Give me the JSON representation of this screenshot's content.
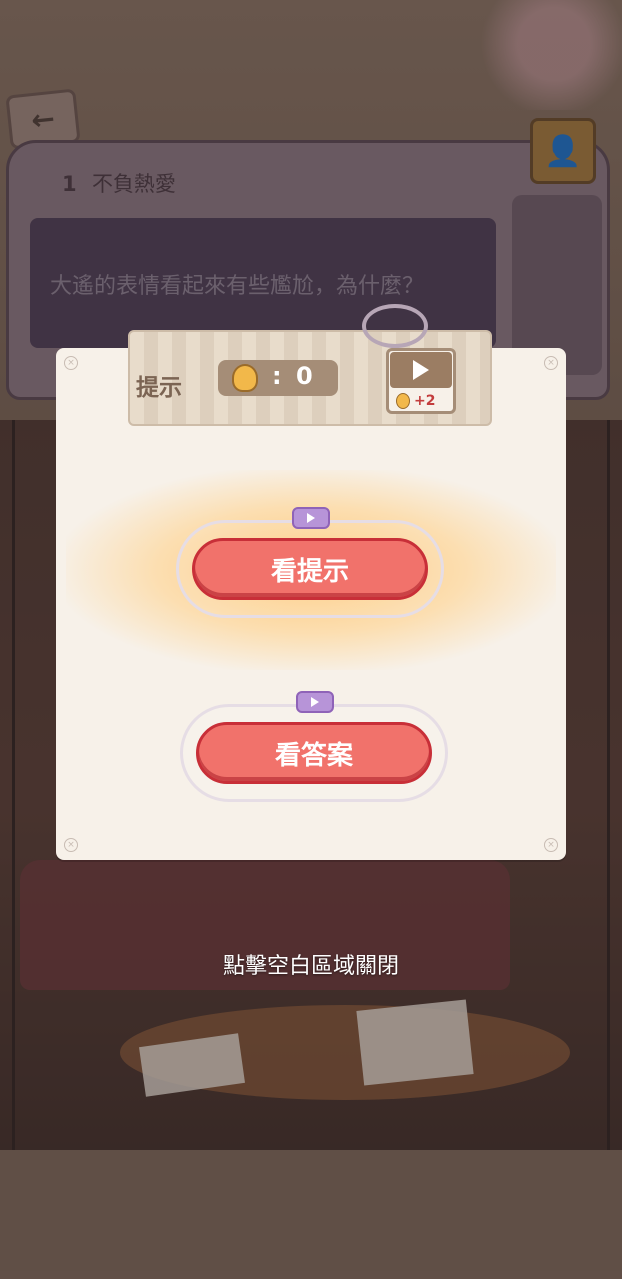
{
  "header": {
    "back_arrow": "←",
    "level_number": "1",
    "level_title": "不負熱愛",
    "question": "大遙的表情看起來有些尷尬，為什麼？"
  },
  "modal": {
    "hint_title": "提示",
    "hint_count": "0",
    "reward_text": "+2",
    "view_hint_label": "看提示",
    "view_answer_label": "看答案"
  },
  "close_hint": "點擊空白區域關閉",
  "colors": {
    "primary_button": "#f1726b",
    "button_border": "#c82f38",
    "video_badge": "#b794d8",
    "modal_bg": "#f7f1e9"
  },
  "icons": {
    "back": "back-arrow-icon",
    "bulb": "lightbulb-icon",
    "video": "video-icon",
    "play": "play-icon"
  }
}
